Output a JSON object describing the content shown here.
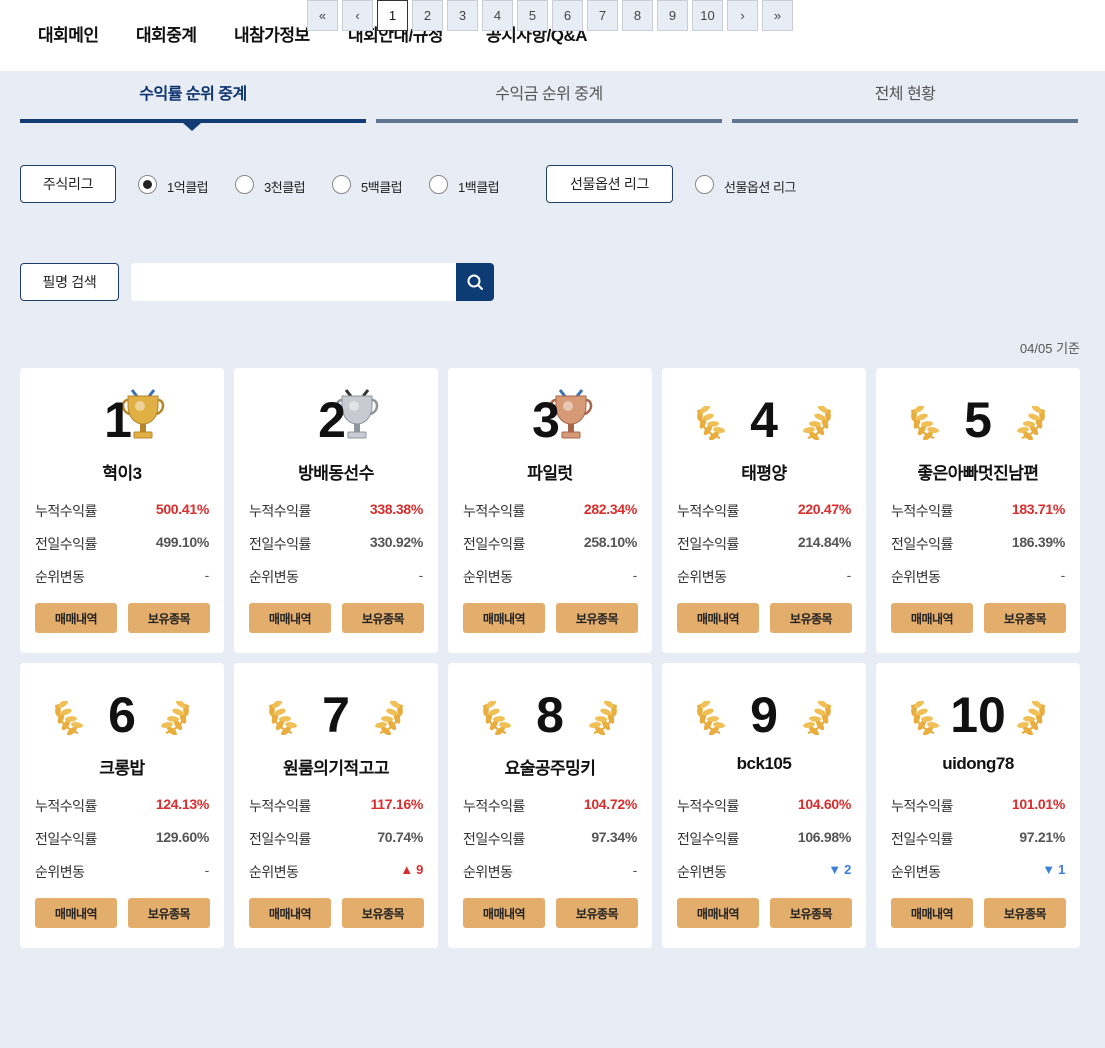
{
  "nav": {
    "items": [
      "대회메인",
      "대회중계",
      "내참가정보",
      "대회안내/규정",
      "공지사항/Q&A"
    ]
  },
  "tabs": [
    {
      "label": "수익률 순위 중계",
      "active": true
    },
    {
      "label": "수익금 순위 중계",
      "active": false
    },
    {
      "label": "전체 현황",
      "active": false
    }
  ],
  "filters": {
    "stock_league_label": "주식리그",
    "stock_options": [
      {
        "label": "1억클럽",
        "checked": true
      },
      {
        "label": "3천클럽",
        "checked": false
      },
      {
        "label": "5백클럽",
        "checked": false
      },
      {
        "label": "1백클럽",
        "checked": false
      }
    ],
    "futures_league_label": "선물옵션 리그",
    "futures_options": [
      {
        "label": "선물옵션 리그",
        "checked": false
      }
    ]
  },
  "search": {
    "button_label": "필명 검색",
    "value": "",
    "placeholder": ""
  },
  "date_label": "04/05 기준",
  "row_labels": {
    "cumulative": "누적수익률",
    "previous": "전일수익률",
    "change": "순위변동"
  },
  "card_buttons": {
    "trades": "매매내역",
    "holdings": "보유종목"
  },
  "rankings": [
    {
      "rank": "1",
      "name": "혁이3",
      "cumulative": "500.41%",
      "previous": "499.10%",
      "change": "-",
      "change_dir": "none",
      "trophy": "gold"
    },
    {
      "rank": "2",
      "name": "방배동선수",
      "cumulative": "338.38%",
      "previous": "330.92%",
      "change": "-",
      "change_dir": "none",
      "trophy": "silver"
    },
    {
      "rank": "3",
      "name": "파일럿",
      "cumulative": "282.34%",
      "previous": "258.10%",
      "change": "-",
      "change_dir": "none",
      "trophy": "bronze"
    },
    {
      "rank": "4",
      "name": "태평양",
      "cumulative": "220.47%",
      "previous": "214.84%",
      "change": "-",
      "change_dir": "none",
      "trophy": "wreath"
    },
    {
      "rank": "5",
      "name": "좋은아빠멋진남편",
      "cumulative": "183.71%",
      "previous": "186.39%",
      "change": "-",
      "change_dir": "none",
      "trophy": "wreath"
    },
    {
      "rank": "6",
      "name": "크롱밥",
      "cumulative": "124.13%",
      "previous": "129.60%",
      "change": "-",
      "change_dir": "none",
      "trophy": "wreath"
    },
    {
      "rank": "7",
      "name": "원룸의기적고고",
      "cumulative": "117.16%",
      "previous": "70.74%",
      "change": "▲ 9",
      "change_dir": "up",
      "trophy": "wreath"
    },
    {
      "rank": "8",
      "name": "요술공주밍키",
      "cumulative": "104.72%",
      "previous": "97.34%",
      "change": "-",
      "change_dir": "none",
      "trophy": "wreath"
    },
    {
      "rank": "9",
      "name": "bck105",
      "cumulative": "104.60%",
      "previous": "106.98%",
      "change": "▼ 2",
      "change_dir": "down",
      "trophy": "wreath"
    },
    {
      "rank": "10",
      "name": "uidong78",
      "cumulative": "101.01%",
      "previous": "97.21%",
      "change": "▼ 1",
      "change_dir": "down",
      "trophy": "wreath"
    }
  ],
  "pagination": {
    "first": "«",
    "prev": "‹",
    "pages": [
      "1",
      "2",
      "3",
      "4",
      "5",
      "6",
      "7",
      "8",
      "9",
      "10"
    ],
    "current": "1",
    "next": "›",
    "last": "»"
  },
  "colors": {
    "navy": "#123c73",
    "tab_inactive_line": "#5f7591",
    "gold_button": "#e3ad6c",
    "positive": "#d92d2d",
    "negative": "#3a7fd5",
    "background": "#e8edf5"
  },
  "icons": {
    "search": "search-icon",
    "trophy_gold": "gold-trophy-icon",
    "trophy_silver": "silver-trophy-icon",
    "trophy_bronze": "bronze-trophy-icon",
    "wreath": "laurel-wreath-icon"
  }
}
